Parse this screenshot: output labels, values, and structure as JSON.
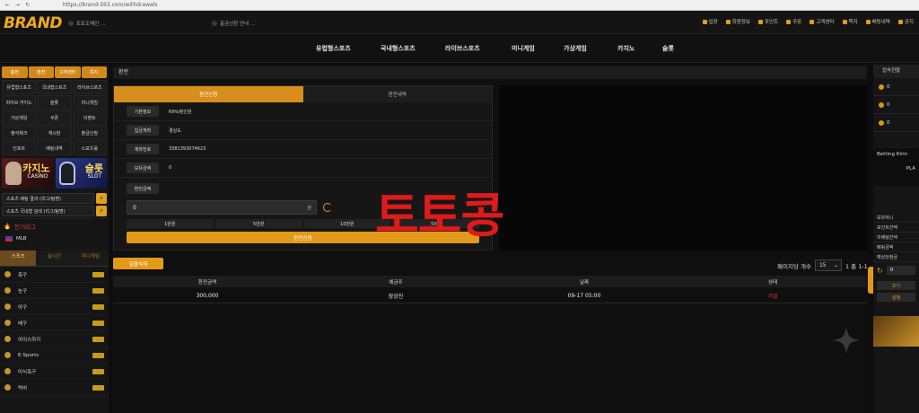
{
  "browser": {
    "url": "https://brand-593.com/withdrawals"
  },
  "header": {
    "logo": "BRAND",
    "ticker1": "토토도메인 ...",
    "ticker2": "출금신청 안내 ...",
    "links": [
      "입장",
      "회원정보",
      "포인트",
      "쿠폰",
      "고객센터",
      "쪽지",
      "배팅내역",
      "공지"
    ]
  },
  "nav": {
    "items": [
      "유럽형스포츠",
      "국내형스포츠",
      "라이브스포츠",
      "미니게임",
      "가상게임",
      "카지노",
      "슬롯"
    ]
  },
  "left": {
    "tabs": [
      "충전",
      "환전",
      "고객센터",
      "쪽지"
    ],
    "grid": [
      "유럽형스포츠",
      "국내형스포츠",
      "라이브스포츠",
      "라이브 카지노",
      "슬롯",
      "미니게임",
      "가상게임",
      "쿠폰",
      "이벤트",
      "출석체크",
      "게시판",
      "출금신청",
      "인포트",
      "배팅내역",
      "스포츠룰"
    ],
    "banner_casino": {
      "title": "카지노",
      "sub": "CASINO"
    },
    "banner_slot": {
      "title": "슬롯",
      "sub": "SLOT"
    },
    "search1": "스포츠 배팅 결과 (리그/팀명)",
    "search2": "스포츠 국내형 검색 (리그/팀명)",
    "section": "인기리그",
    "league": "MLB",
    "sport_tabs": [
      "스포츠",
      "실시간",
      "미니게임"
    ],
    "sports": [
      "축구",
      "농구",
      "야구",
      "배구",
      "아이스하키",
      "E-Sports",
      "미식축구",
      "럭비"
    ]
  },
  "main": {
    "title": "환전",
    "tabs": [
      "환전신청",
      "환전내역"
    ],
    "rows": [
      {
        "k": "기본정보",
        "v": "RIHo짐인원"
      },
      {
        "k": "입금계좌",
        "v": "경상도"
      },
      {
        "k": "계좌번호",
        "v": "3381393074623"
      },
      {
        "k": "보유금액",
        "v": "0"
      }
    ],
    "amount_label": "환전금액",
    "amount_value": "0",
    "amount_unit": "원",
    "quick": [
      "1만원",
      "5만원",
      "10만원",
      "50만"
    ],
    "submit": "환전신청",
    "watermark": "토토콩",
    "delete_btn": "일괄삭제",
    "pager_label": "페이지당 개수",
    "pager_value": "15",
    "pager_range": "1 총 1-1",
    "table_headers": [
      "환전금액",
      "예금주",
      "날짜",
      "상태"
    ],
    "table_rows": [
      {
        "amount": "300,000",
        "holder": "장상진",
        "date": "09-17 05:00",
        "status": "거절"
      }
    ]
  },
  "right": {
    "head": "접속현황",
    "rows": [
      "0",
      "0",
      "0"
    ],
    "betting_label": "Betting Kirin",
    "play_label": "PLA",
    "list": [
      "보유머니",
      "포인트잔액",
      "미배팅잔액",
      "배팅금액",
      "예상당첨금"
    ],
    "amount": "0",
    "btn1": "초기",
    "btn2": "실행"
  },
  "colors": {
    "accent": "#e39a1a",
    "watermark": "#e01a1a",
    "bg": "#0d0d0d"
  }
}
